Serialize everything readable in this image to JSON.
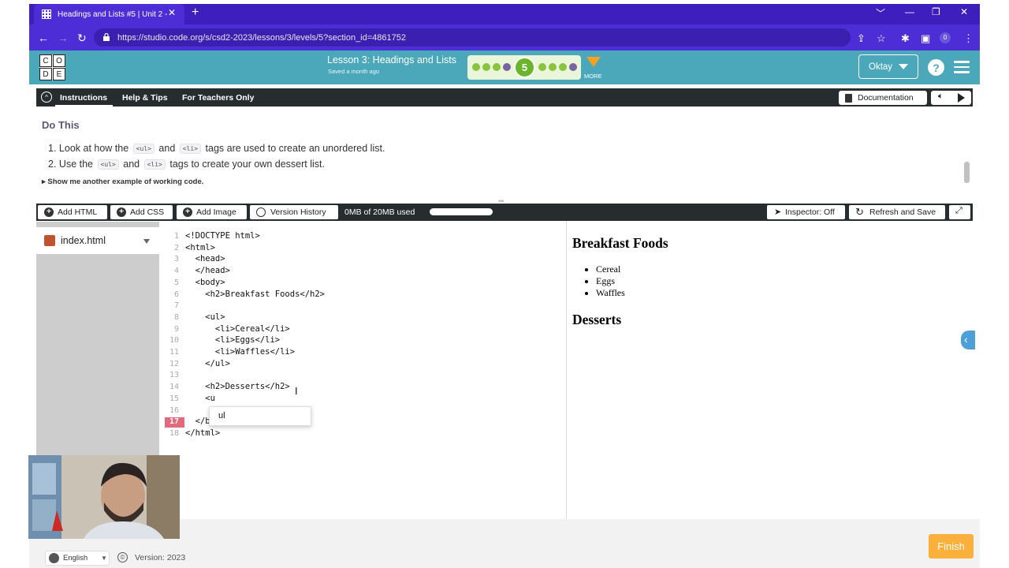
{
  "browser": {
    "tab_title": "Headings and Lists #5 | Unit 2 -",
    "tab_close": "✕",
    "new_tab": "+",
    "url": "https://studio.code.org/s/csd2-2023/lessons/3/levels/5?section_id=4861752",
    "minimize": "﹀",
    "restore": "—",
    "maximize": "❐",
    "close": "✕",
    "profile_count": "0"
  },
  "header": {
    "logo_letters": [
      "C",
      "O",
      "D",
      "E"
    ],
    "lesson_title": "Lesson 3: Headings and Lists",
    "saved": "Saved a month ago",
    "progress": {
      "current_level": "5",
      "total_dots": 9
    },
    "more": "MORE",
    "user": "Oktay",
    "help": "?"
  },
  "instructions": {
    "tabs": [
      "Instructions",
      "Help & Tips",
      "For Teachers Only"
    ],
    "documentation": "Documentation",
    "heading": "Do This",
    "steps": [
      {
        "num": "1.",
        "pre": "Look at how the",
        "tag1": "<ul>",
        "mid": "and",
        "tag2": "<li>",
        "post": "tags are used to create an unordered list."
      },
      {
        "num": "2.",
        "pre": "Use the",
        "tag1": "<ul>",
        "mid": "and",
        "tag2": "<li>",
        "post": "tags to create your own dessert list."
      }
    ],
    "example_toggle": "▸ Show me another example of working code."
  },
  "toolbar": {
    "add_html": "Add HTML",
    "add_css": "Add CSS",
    "add_image": "Add Image",
    "version_history": "Version History",
    "storage": "0MB of 20MB used",
    "storage_used_fraction": 0.0,
    "inspector": "Inspector: Off",
    "refresh_save": "Refresh and Save"
  },
  "files": {
    "current": "index.html"
  },
  "editor": {
    "lines": [
      "<!DOCTYPE html>",
      "<html>",
      "  <head>",
      "  </head>",
      "  <body>",
      "    <h2>Breakfast Foods</h2>",
      "",
      "    <ul>",
      "      <li>Cereal</li>",
      "      <li>Eggs</li>",
      "      <li>Waffles</li>",
      "    </ul>",
      "",
      "    <h2>Desserts</h2>",
      "    <u",
      "",
      "  </bo",
      "</html>"
    ],
    "line_numbers": [
      "1",
      "2",
      "3",
      "4",
      "5",
      "6",
      "7",
      "8",
      "9",
      "10",
      "11",
      "12",
      "13",
      "14",
      "15",
      "16",
      "17",
      "18"
    ],
    "error_line": "17",
    "autocomplete_option": "ul"
  },
  "preview": {
    "heading1": "Breakfast Foods",
    "items": [
      "Cereal",
      "Eggs",
      "Waffles"
    ],
    "heading2": "Desserts"
  },
  "footer": {
    "language": "English",
    "version": "Version: 2023",
    "finish": "Finish"
  },
  "colors": {
    "browser_chrome": "#4d2ed6",
    "header_teal": "#4aa8ba",
    "dark_bar": "#272c2f",
    "progress_green": "#8ac43f",
    "progress_purple": "#7665a0",
    "more_orange": "#f4a21f",
    "error_line": "#e36a7c",
    "finish_orange": "#fbb03b"
  }
}
